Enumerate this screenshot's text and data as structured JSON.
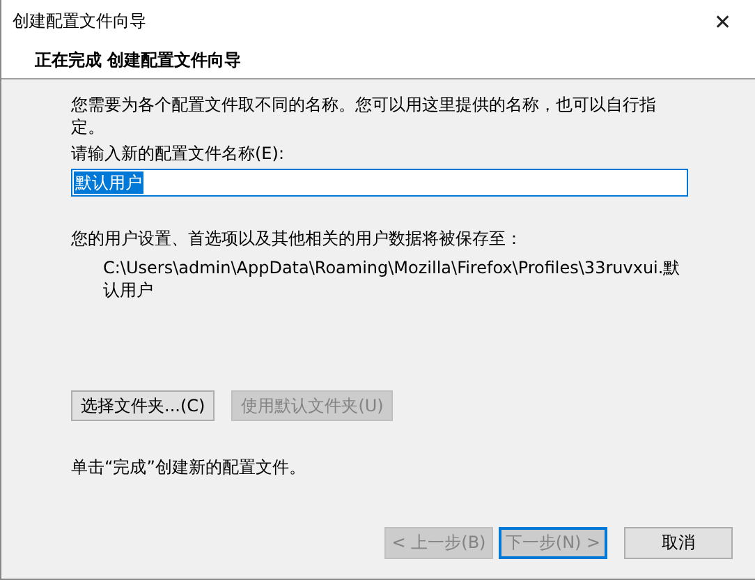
{
  "window": {
    "title": "创建配置文件向导",
    "close": "✕"
  },
  "header": {
    "title": "正在完成 创建配置文件向导"
  },
  "intro": "您需要为各个配置文件取不同的名称。您可以用这里提供的名称，也可以自行指定。",
  "name_field": {
    "label": "请输入新的配置文件名称(E):",
    "value": "默认用户",
    "selected": true
  },
  "save_info": "您的用户设置、首选项以及其他相关的用户数据将被保存至：",
  "path": "C:\\Users\\admin\\AppData\\Roaming\\Mozilla\\Firefox\\Profiles\\33ruvxui.默认用户",
  "folder_buttons": [
    {
      "label": "选择文件夹...(C)",
      "disabled": false
    },
    {
      "label": "使用默认文件夹(U)",
      "disabled": true
    }
  ],
  "finish_hint": "单击“完成”创建新的配置文件。",
  "nav_buttons": [
    {
      "label": "< 上一步(B)",
      "disabled": true,
      "default": false
    },
    {
      "label": "下一步(N) >",
      "disabled": true,
      "default": true
    },
    {
      "label": "取消",
      "disabled": false,
      "default": false
    }
  ]
}
